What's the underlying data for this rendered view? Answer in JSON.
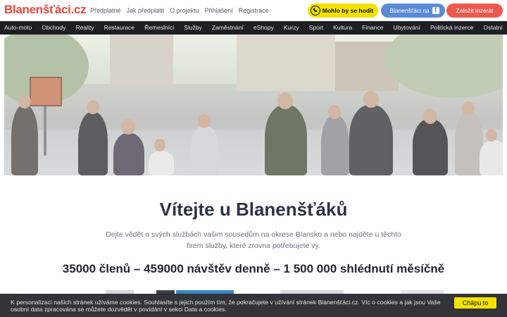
{
  "header": {
    "logo_text": "Blanenšťáci.cz",
    "links": [
      "Předplatné",
      "Jak předplatit",
      "O projektu",
      "Přihlášení",
      "Registrace"
    ],
    "call_button": "Mohlo by se hodit",
    "facebook_button": "Blanenšťáci na",
    "add_button": "Založit inzerát"
  },
  "nav": {
    "items": [
      "Auto-moto",
      "Obchody",
      "Reality",
      "Restaurace",
      "Řemeslníci",
      "Služby",
      "Zaměstnání",
      "eShopy",
      "Kurzy",
      "Sport",
      "Kultura",
      "Finance",
      "Ubytování",
      "Politická inzerce",
      "Ostatní"
    ]
  },
  "hero": {
    "image_icon": "crowd-photo"
  },
  "main": {
    "title": "Vítejte u Blanenšťáků",
    "subtitle": "Dejte vědět o svých službách vašim sousedům na okrese Blansko a nebo najděte u těchto firem služby, které zrovna potřebujete vy.",
    "stats": "35000 členů – 459000 návštěv denně – 1 500 000 shlédnutí měsíčně"
  },
  "cookie": {
    "text": "K personalizaci našich stránek užíváme cookies. Souhlasíte s jejich použím tím, že pokračujete v užívání stránek Blanenšťáci.cz. Víc o cookies a jak jsou Vaše osobní data zpracována se můžete dozvědět v povídání v sekci Data a cookies.",
    "accept": "Chápu to"
  },
  "colors": {
    "brand": "#e8473a",
    "nav_bg": "#1d1f24",
    "call": "#f3e200",
    "facebook": "#5b8bd6",
    "add": "#ec5a4f"
  }
}
